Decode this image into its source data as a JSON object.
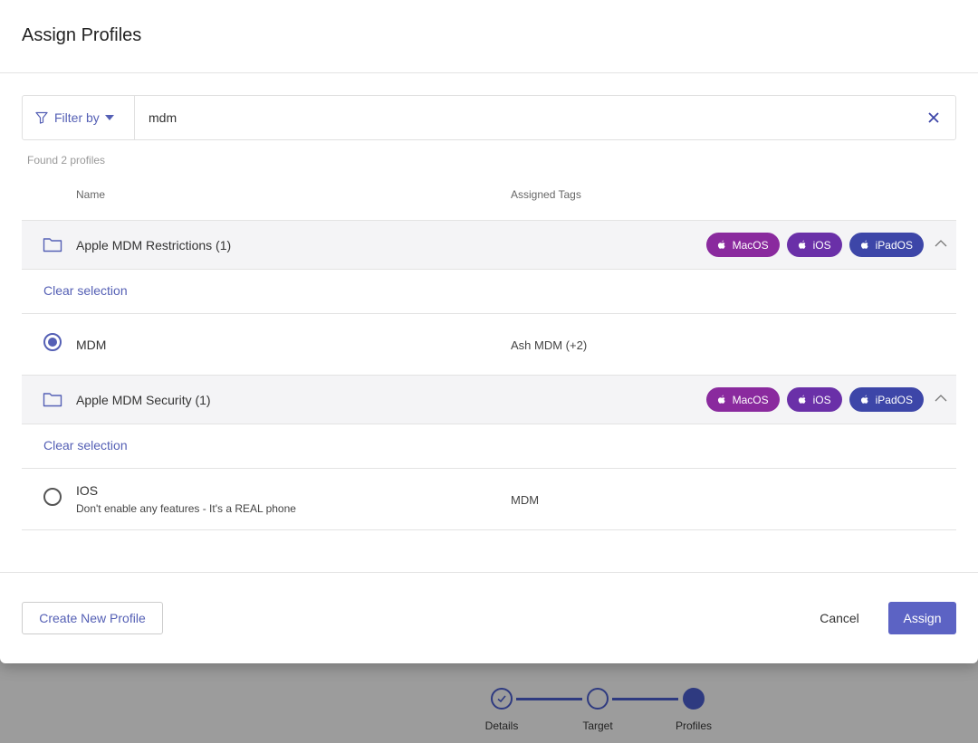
{
  "modal": {
    "title": "Assign Profiles"
  },
  "filter": {
    "label": "Filter by",
    "search_value": "mdm"
  },
  "results": {
    "found_text": "Found 2 profiles"
  },
  "columns": {
    "name": "Name",
    "assigned_tags": "Assigned Tags"
  },
  "groups": [
    {
      "name": "Apple MDM Restrictions (1)",
      "tags": [
        "MacOS",
        "iOS",
        "iPadOS"
      ],
      "clear_label": "Clear selection",
      "items": [
        {
          "name": "MDM",
          "description": "",
          "tags": "Ash MDM (+2)",
          "selected": true
        }
      ]
    },
    {
      "name": "Apple MDM Security (1)",
      "tags": [
        "MacOS",
        "iOS",
        "iPadOS"
      ],
      "clear_label": "Clear selection",
      "items": [
        {
          "name": "IOS",
          "description": "Don't enable any features - It's a REAL phone",
          "tags": "MDM",
          "selected": false
        }
      ]
    }
  ],
  "footer": {
    "create_label": "Create New Profile",
    "cancel_label": "Cancel",
    "assign_label": "Assign"
  },
  "stepper": {
    "steps": [
      "Details",
      "Target",
      "Profiles"
    ]
  },
  "colors": {
    "accent": "#5560b5",
    "primary_button": "#5c63c4",
    "tag_macos": "#8a2a9e",
    "tag_ios": "#6a30a8",
    "tag_ipados": "#3d46a8",
    "stepper": "#2e3a80"
  }
}
